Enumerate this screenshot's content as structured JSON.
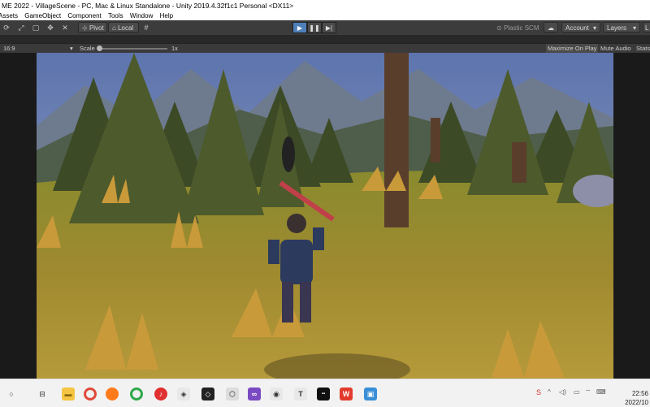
{
  "window": {
    "title": "ME 2022 - VillageScene - PC, Mac & Linux Standalone - Unity 2019.4.32f1c1 Personal <DX11>"
  },
  "menu": {
    "items": [
      "Assets",
      "GameObject",
      "Component",
      "Tools",
      "Window",
      "Help"
    ]
  },
  "toolbar": {
    "pivot_label": "Pivot",
    "local_label": "Local",
    "plastic_label": "Plastic SCM",
    "account_label": "Account",
    "layers_label": "Layers",
    "layout_label": "L"
  },
  "game_view": {
    "aspect": "16:9",
    "scale_label": "Scale",
    "scale_value": "1x",
    "maximize_label": "Maximize On Play",
    "mute_label": "Mute Audio",
    "stats_label": "Stats"
  },
  "taskbar": {
    "clock_time": "22:56",
    "clock_date": "2022/10",
    "icons": [
      "search-icon",
      "task-view-icon",
      "file-explorer-icon",
      "chrome-icon",
      "firefox-icon",
      "chrome-icon-2",
      "netease-music-icon",
      "photo-app-icon",
      "unity-icon",
      "unity-hub-icon",
      "visual-studio-icon",
      "qq-icon",
      "typora-icon",
      "foxit-icon",
      "wps-icon",
      "photos-icon"
    ]
  },
  "colors": {
    "unity_toolbar": "#3c3c3c",
    "play_active": "#4f7fb8",
    "grass": "#9a8a2c",
    "sky": "#6f86b8"
  }
}
